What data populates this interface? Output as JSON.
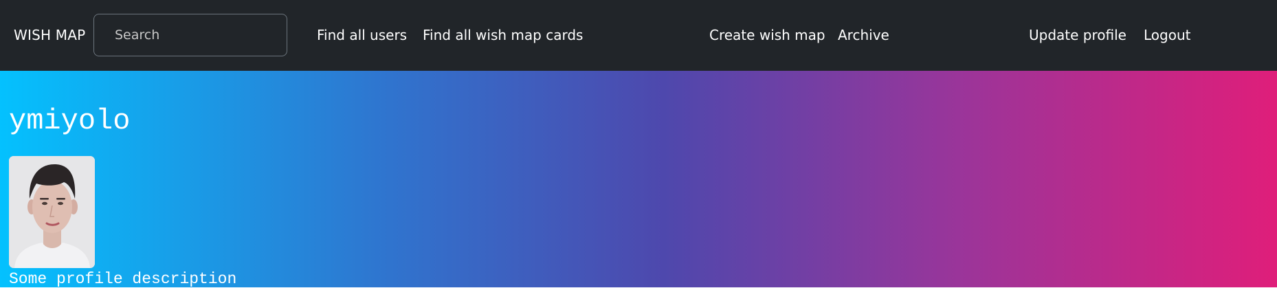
{
  "navbar": {
    "brand": "WISH MAP",
    "search_placeholder": "Search",
    "links": {
      "find_all_users": "Find all users",
      "find_all_wish_map_cards": "Find all wish map cards",
      "create_wish_map": "Create wish map",
      "archive": "Archive",
      "update_profile": "Update profile",
      "logout": "Logout"
    }
  },
  "profile": {
    "username": "ymiyolo",
    "description": "Some profile description",
    "avatar_icon": "profile-photo"
  },
  "colors": {
    "navbar_bg": "#212529",
    "gradient_start": "#04c1fe",
    "gradient_mid": "#4e48ad",
    "gradient_end": "#df1e7a"
  }
}
